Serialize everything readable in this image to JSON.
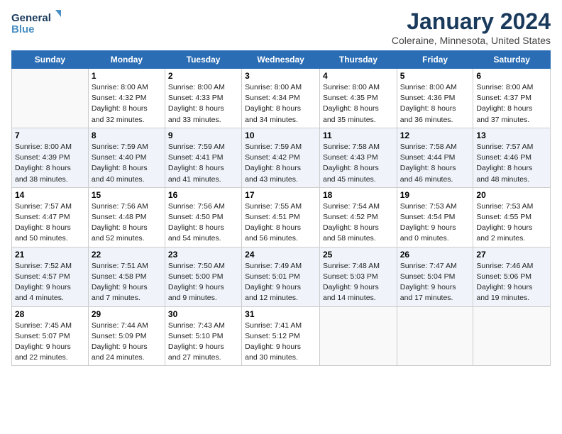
{
  "logo": {
    "line1": "General",
    "line2": "Blue"
  },
  "title": "January 2024",
  "subtitle": "Coleraine, Minnesota, United States",
  "days_header": [
    "Sunday",
    "Monday",
    "Tuesday",
    "Wednesday",
    "Thursday",
    "Friday",
    "Saturday"
  ],
  "weeks": [
    [
      {
        "num": "",
        "info": ""
      },
      {
        "num": "1",
        "info": "Sunrise: 8:00 AM\nSunset: 4:32 PM\nDaylight: 8 hours\nand 32 minutes."
      },
      {
        "num": "2",
        "info": "Sunrise: 8:00 AM\nSunset: 4:33 PM\nDaylight: 8 hours\nand 33 minutes."
      },
      {
        "num": "3",
        "info": "Sunrise: 8:00 AM\nSunset: 4:34 PM\nDaylight: 8 hours\nand 34 minutes."
      },
      {
        "num": "4",
        "info": "Sunrise: 8:00 AM\nSunset: 4:35 PM\nDaylight: 8 hours\nand 35 minutes."
      },
      {
        "num": "5",
        "info": "Sunrise: 8:00 AM\nSunset: 4:36 PM\nDaylight: 8 hours\nand 36 minutes."
      },
      {
        "num": "6",
        "info": "Sunrise: 8:00 AM\nSunset: 4:37 PM\nDaylight: 8 hours\nand 37 minutes."
      }
    ],
    [
      {
        "num": "7",
        "info": "Sunrise: 8:00 AM\nSunset: 4:39 PM\nDaylight: 8 hours\nand 38 minutes."
      },
      {
        "num": "8",
        "info": "Sunrise: 7:59 AM\nSunset: 4:40 PM\nDaylight: 8 hours\nand 40 minutes."
      },
      {
        "num": "9",
        "info": "Sunrise: 7:59 AM\nSunset: 4:41 PM\nDaylight: 8 hours\nand 41 minutes."
      },
      {
        "num": "10",
        "info": "Sunrise: 7:59 AM\nSunset: 4:42 PM\nDaylight: 8 hours\nand 43 minutes."
      },
      {
        "num": "11",
        "info": "Sunrise: 7:58 AM\nSunset: 4:43 PM\nDaylight: 8 hours\nand 45 minutes."
      },
      {
        "num": "12",
        "info": "Sunrise: 7:58 AM\nSunset: 4:44 PM\nDaylight: 8 hours\nand 46 minutes."
      },
      {
        "num": "13",
        "info": "Sunrise: 7:57 AM\nSunset: 4:46 PM\nDaylight: 8 hours\nand 48 minutes."
      }
    ],
    [
      {
        "num": "14",
        "info": "Sunrise: 7:57 AM\nSunset: 4:47 PM\nDaylight: 8 hours\nand 50 minutes."
      },
      {
        "num": "15",
        "info": "Sunrise: 7:56 AM\nSunset: 4:48 PM\nDaylight: 8 hours\nand 52 minutes."
      },
      {
        "num": "16",
        "info": "Sunrise: 7:56 AM\nSunset: 4:50 PM\nDaylight: 8 hours\nand 54 minutes."
      },
      {
        "num": "17",
        "info": "Sunrise: 7:55 AM\nSunset: 4:51 PM\nDaylight: 8 hours\nand 56 minutes."
      },
      {
        "num": "18",
        "info": "Sunrise: 7:54 AM\nSunset: 4:52 PM\nDaylight: 8 hours\nand 58 minutes."
      },
      {
        "num": "19",
        "info": "Sunrise: 7:53 AM\nSunset: 4:54 PM\nDaylight: 9 hours\nand 0 minutes."
      },
      {
        "num": "20",
        "info": "Sunrise: 7:53 AM\nSunset: 4:55 PM\nDaylight: 9 hours\nand 2 minutes."
      }
    ],
    [
      {
        "num": "21",
        "info": "Sunrise: 7:52 AM\nSunset: 4:57 PM\nDaylight: 9 hours\nand 4 minutes."
      },
      {
        "num": "22",
        "info": "Sunrise: 7:51 AM\nSunset: 4:58 PM\nDaylight: 9 hours\nand 7 minutes."
      },
      {
        "num": "23",
        "info": "Sunrise: 7:50 AM\nSunset: 5:00 PM\nDaylight: 9 hours\nand 9 minutes."
      },
      {
        "num": "24",
        "info": "Sunrise: 7:49 AM\nSunset: 5:01 PM\nDaylight: 9 hours\nand 12 minutes."
      },
      {
        "num": "25",
        "info": "Sunrise: 7:48 AM\nSunset: 5:03 PM\nDaylight: 9 hours\nand 14 minutes."
      },
      {
        "num": "26",
        "info": "Sunrise: 7:47 AM\nSunset: 5:04 PM\nDaylight: 9 hours\nand 17 minutes."
      },
      {
        "num": "27",
        "info": "Sunrise: 7:46 AM\nSunset: 5:06 PM\nDaylight: 9 hours\nand 19 minutes."
      }
    ],
    [
      {
        "num": "28",
        "info": "Sunrise: 7:45 AM\nSunset: 5:07 PM\nDaylight: 9 hours\nand 22 minutes."
      },
      {
        "num": "29",
        "info": "Sunrise: 7:44 AM\nSunset: 5:09 PM\nDaylight: 9 hours\nand 24 minutes."
      },
      {
        "num": "30",
        "info": "Sunrise: 7:43 AM\nSunset: 5:10 PM\nDaylight: 9 hours\nand 27 minutes."
      },
      {
        "num": "31",
        "info": "Sunrise: 7:41 AM\nSunset: 5:12 PM\nDaylight: 9 hours\nand 30 minutes."
      },
      {
        "num": "",
        "info": ""
      },
      {
        "num": "",
        "info": ""
      },
      {
        "num": "",
        "info": ""
      }
    ]
  ]
}
